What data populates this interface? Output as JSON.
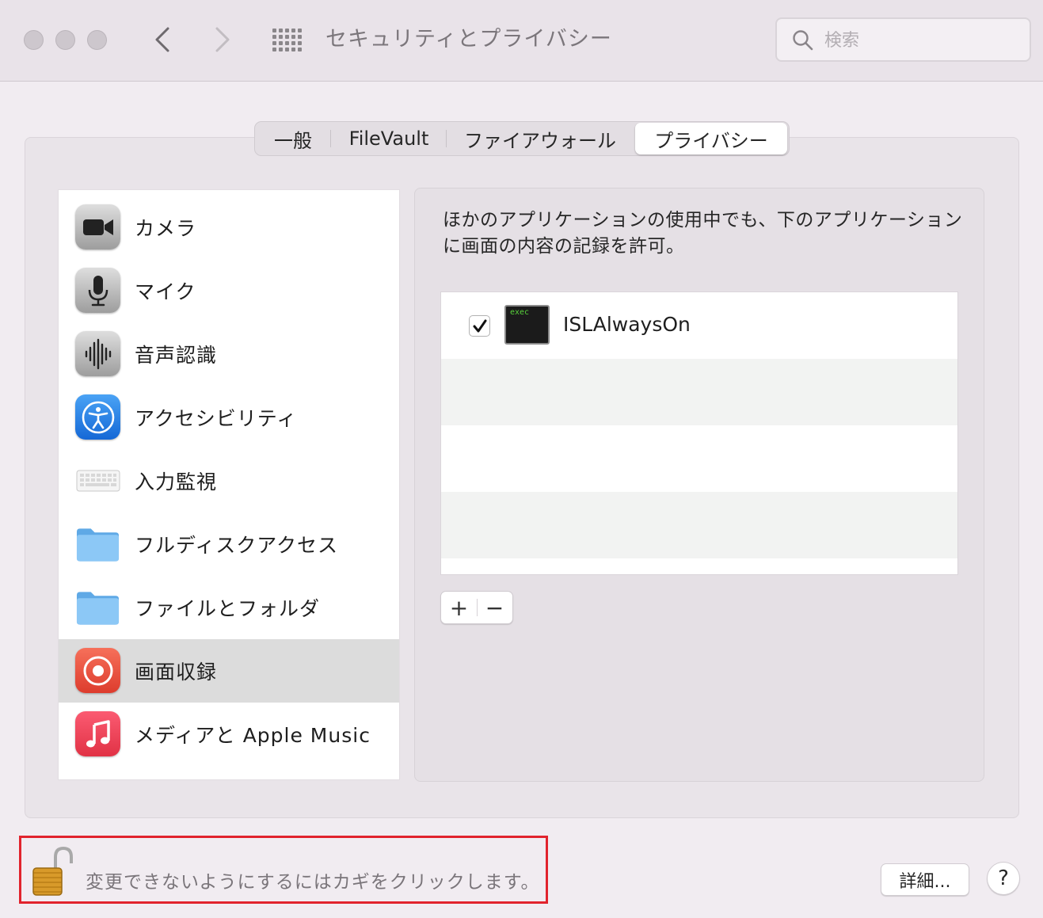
{
  "window": {
    "title": "セキュリティとプライバシー",
    "back_icon": "chevron-left-icon",
    "forward_icon": "chevron-right-icon",
    "grid_icon": "show-all-grid-icon"
  },
  "search": {
    "placeholder": "検索",
    "value": ""
  },
  "tabs": [
    {
      "label": "一般",
      "active": false
    },
    {
      "label": "FileVault",
      "active": false
    },
    {
      "label": "ファイアウォール",
      "active": false
    },
    {
      "label": "プライバシー",
      "active": true
    }
  ],
  "sidebar": {
    "items": [
      {
        "label": "カメラ",
        "icon": "camera-icon",
        "selected": false
      },
      {
        "label": "マイク",
        "icon": "microphone-icon",
        "selected": false
      },
      {
        "label": "音声認識",
        "icon": "waveform-icon",
        "selected": false
      },
      {
        "label": "アクセシビリティ",
        "icon": "accessibility-icon",
        "selected": false
      },
      {
        "label": "入力監視",
        "icon": "keyboard-icon",
        "selected": false
      },
      {
        "label": "フルディスクアクセス",
        "icon": "folder-icon",
        "selected": false
      },
      {
        "label": "ファイルとフォルダ",
        "icon": "folder-icon",
        "selected": false
      },
      {
        "label": "画面収録",
        "icon": "screen-record-icon",
        "selected": true
      },
      {
        "label": "メディアと Apple Music",
        "icon": "music-icon",
        "selected": false
      }
    ]
  },
  "main": {
    "description": "ほかのアプリケーションの使用中でも、下のアプリケーションに画面の内容の記録を許可。",
    "apps": [
      {
        "name": "ISLAlwaysOn",
        "checked": true,
        "icon": "exec-terminal-icon",
        "icon_text": "exec"
      }
    ],
    "add_label": "+",
    "remove_label": "−"
  },
  "footer": {
    "lock_text": "変更できないようにするにはカギをクリックします。",
    "lock_icon": "unlocked-padlock-icon",
    "details_label": "詳細...",
    "help_label": "?"
  },
  "colors": {
    "accent_highlight": "#e1232d",
    "selected_row": "#dcdcdc"
  }
}
